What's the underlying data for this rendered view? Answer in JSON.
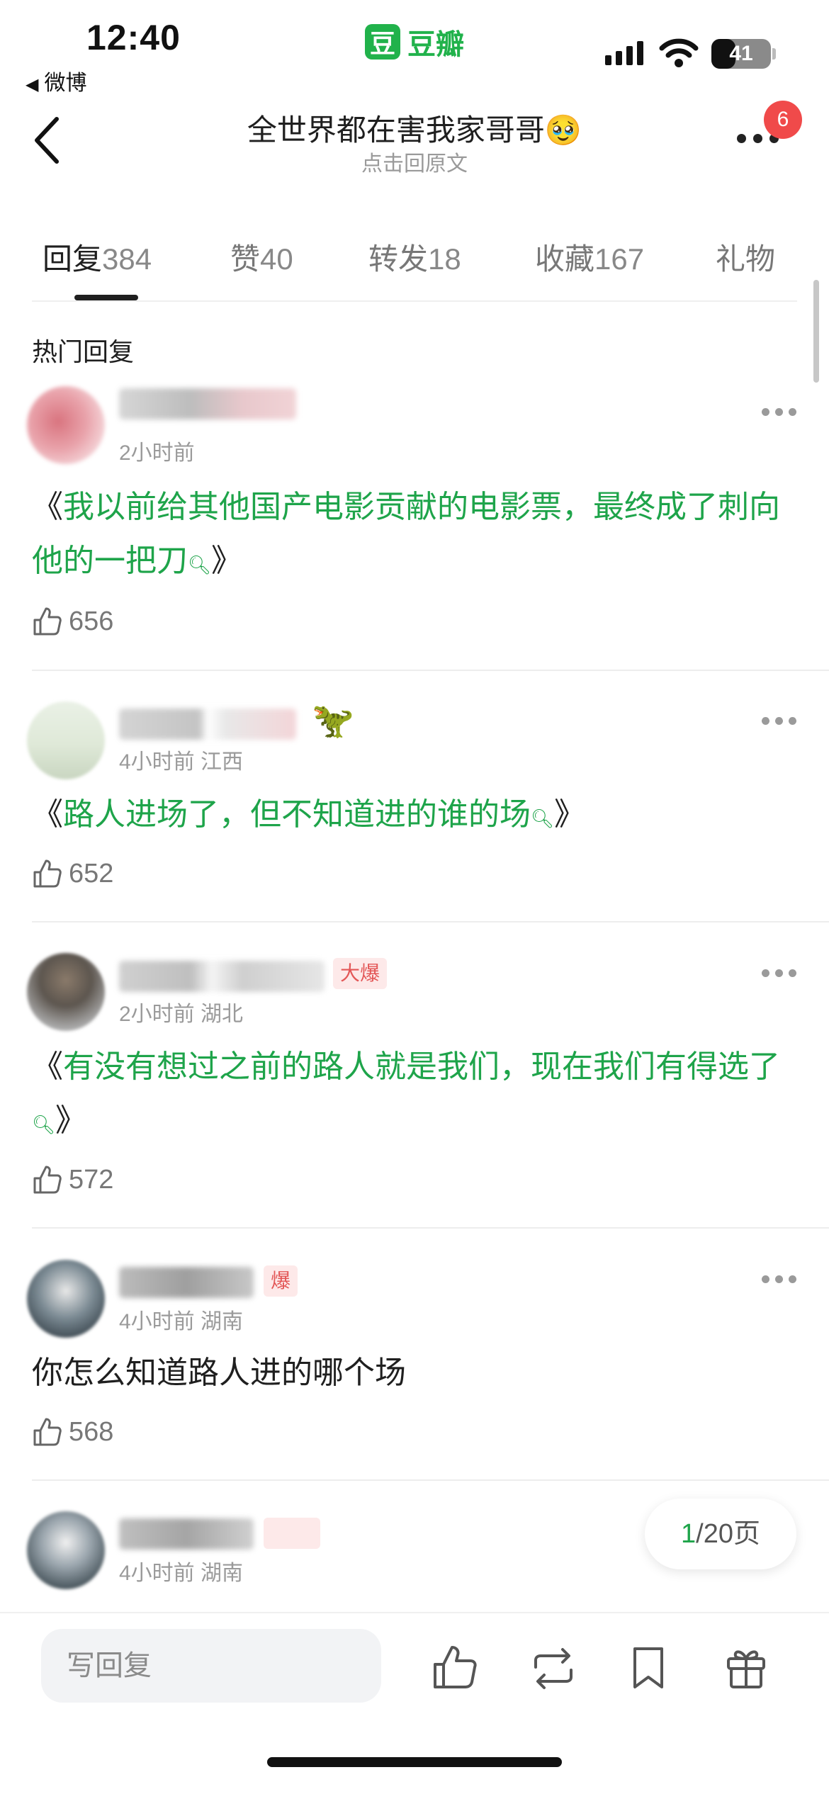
{
  "status_bar": {
    "time": "12:40",
    "back_app": "微博",
    "brand_logo_char": "豆",
    "brand_name": "豆瓣",
    "battery": "41",
    "battery_level": 0.41
  },
  "nav": {
    "title": "全世界都在害我家哥哥🥹",
    "subtitle": "点击回原文",
    "notification_count": "6"
  },
  "tabs": [
    {
      "label": "回复",
      "count": "384",
      "active": true
    },
    {
      "label": "赞",
      "count": "40",
      "active": false
    },
    {
      "label": "转发",
      "count": "18",
      "active": false
    },
    {
      "label": "收藏",
      "count": "167",
      "active": false
    },
    {
      "label": "礼物",
      "count": "",
      "active": false
    }
  ],
  "section_title": "热门回复",
  "comments": [
    {
      "time": "2小时前",
      "location": "",
      "open_bracket": "《",
      "text": "我以前给其他国产电影贡献的电影票，最终成了刺向他的一把刀",
      "close_bracket": "》",
      "likes": "656",
      "linked": true
    },
    {
      "time": "4小时前",
      "location": "江西",
      "open_bracket": "《",
      "text": "路人进场了，但不知道进的谁的场",
      "close_bracket": "》",
      "likes": "652",
      "linked": true
    },
    {
      "time": "2小时前",
      "location": "湖北",
      "tag": "大爆",
      "open_bracket": "《",
      "text": "有没有想过之前的路人就是我们，现在我们有得选了",
      "close_bracket": "》",
      "likes": "572",
      "linked": true
    },
    {
      "time": "4小时前",
      "location": "湖南",
      "tag": "爆",
      "text": "你怎么知道路人进的哪个场",
      "likes": "568",
      "linked": false
    },
    {
      "time": "4小时前",
      "location": "湖南"
    }
  ],
  "pager": {
    "current": "1",
    "total": "/20页"
  },
  "bottom_bar": {
    "reply_placeholder": "写回复",
    "icons": [
      "thumbs-up-icon",
      "repost-icon",
      "bookmark-icon",
      "gift-icon"
    ]
  },
  "colors": {
    "accent_green": "#1ea44a",
    "badge_red": "#f04a4a"
  }
}
